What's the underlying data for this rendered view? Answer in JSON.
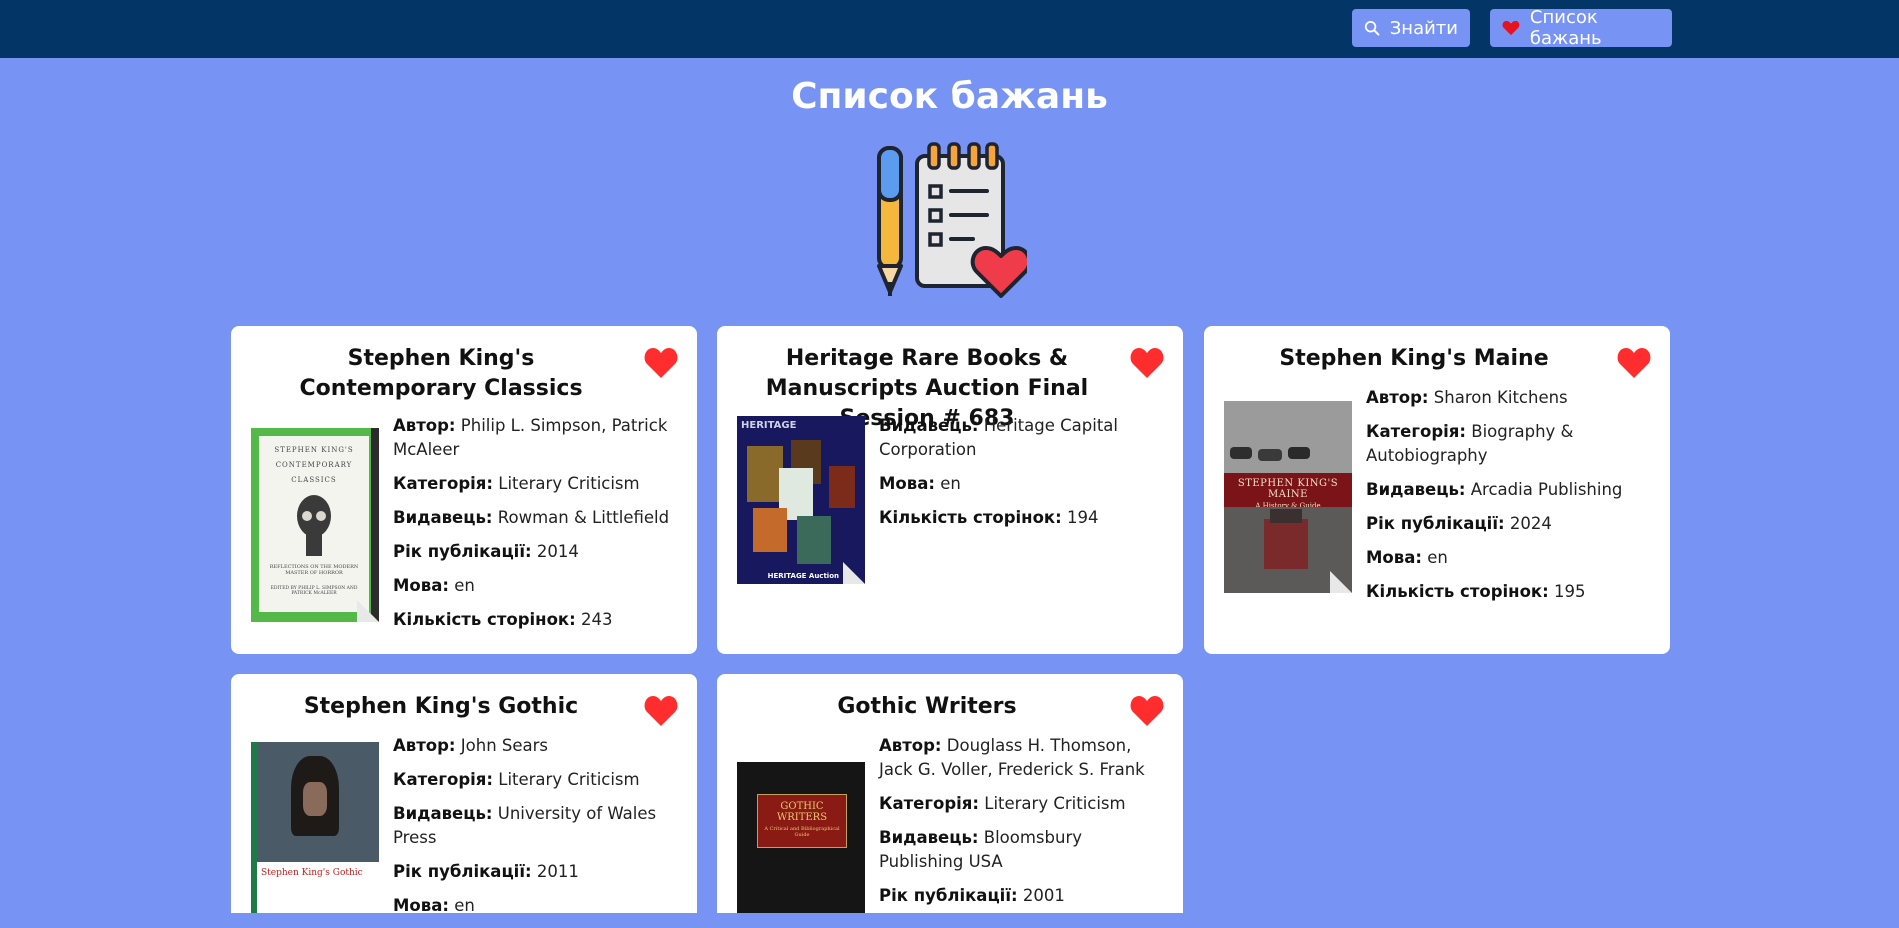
{
  "nav": {
    "search_label": "Знайти",
    "wishlist_label": "Список бажань"
  },
  "page": {
    "title": "Список бажань"
  },
  "colors": {
    "navbar": "#033566",
    "background": "#7794f5",
    "button": "#7794f5",
    "heart": "#ff2d2d"
  },
  "cards": [
    {
      "title": "Stephen King's Contemporary Classics",
      "fields": [
        {
          "label": "Автор:",
          "value": "Philip L. Simpson, Patrick McAleer"
        },
        {
          "label": "Категорія:",
          "value": "Literary Criticism"
        },
        {
          "label": "Видавець:",
          "value": "Rowman & Littlefield"
        },
        {
          "label": "Рік публікації:",
          "value": "2014"
        },
        {
          "label": "Мова:",
          "value": "en"
        },
        {
          "label": "Кількість сторінок:",
          "value": "243"
        }
      ],
      "cover": {
        "line1": "STEPHEN KING'S",
        "line2": "CONTEMPORARY",
        "line3": "CLASSICS",
        "sub": "REFLECTIONS ON THE MODERN MASTER OF HORROR",
        "editors": "EDITED BY PHILIP L. SIMPSON AND PATRICK McALEER"
      }
    },
    {
      "title": "Heritage Rare Books & Manuscripts Auction Final Session # 683",
      "fields": [
        {
          "label": "Видавець:",
          "value": "Heritage Capital Corporation"
        },
        {
          "label": "Мова:",
          "value": "en"
        },
        {
          "label": "Кількість сторінок:",
          "value": "194"
        }
      ],
      "cover": {
        "top": "HERITAGE",
        "bottom": "HERITAGE Auction"
      }
    },
    {
      "title": "Stephen King's Maine",
      "fields": [
        {
          "label": "Автор:",
          "value": "Sharon Kitchens"
        },
        {
          "label": "Категорія:",
          "value": "Biography & Autobiography"
        },
        {
          "label": "Видавець:",
          "value": "Arcadia Publishing"
        },
        {
          "label": "Рік публікації:",
          "value": "2024"
        },
        {
          "label": "Мова:",
          "value": "en"
        },
        {
          "label": "Кількість сторінок:",
          "value": "195"
        }
      ],
      "cover": {
        "title": "STEPHEN KING'S MAINE",
        "sub": "A History & Guide"
      }
    },
    {
      "title": "Stephen King's Gothic",
      "fields": [
        {
          "label": "Автор:",
          "value": "John Sears"
        },
        {
          "label": "Категорія:",
          "value": "Literary Criticism"
        },
        {
          "label": "Видавець:",
          "value": "University of Wales Press"
        },
        {
          "label": "Рік публікації:",
          "value": "2011"
        },
        {
          "label": "Мова:",
          "value": "en"
        }
      ],
      "cover": {
        "title": "Stephen King's Gothic"
      }
    },
    {
      "title": "Gothic Writers",
      "fields": [
        {
          "label": "Автор:",
          "value": "Douglass H. Thomson, Jack G. Voller, Frederick S. Frank"
        },
        {
          "label": "Категорія:",
          "value": "Literary Criticism"
        },
        {
          "label": "Видавець:",
          "value": "Bloomsbury Publishing USA"
        },
        {
          "label": "Рік публікації:",
          "value": "2001"
        }
      ],
      "cover": {
        "title": "GOTHIC WRITERS",
        "sub": "A Critical and Bibliographical Guide"
      }
    }
  ]
}
